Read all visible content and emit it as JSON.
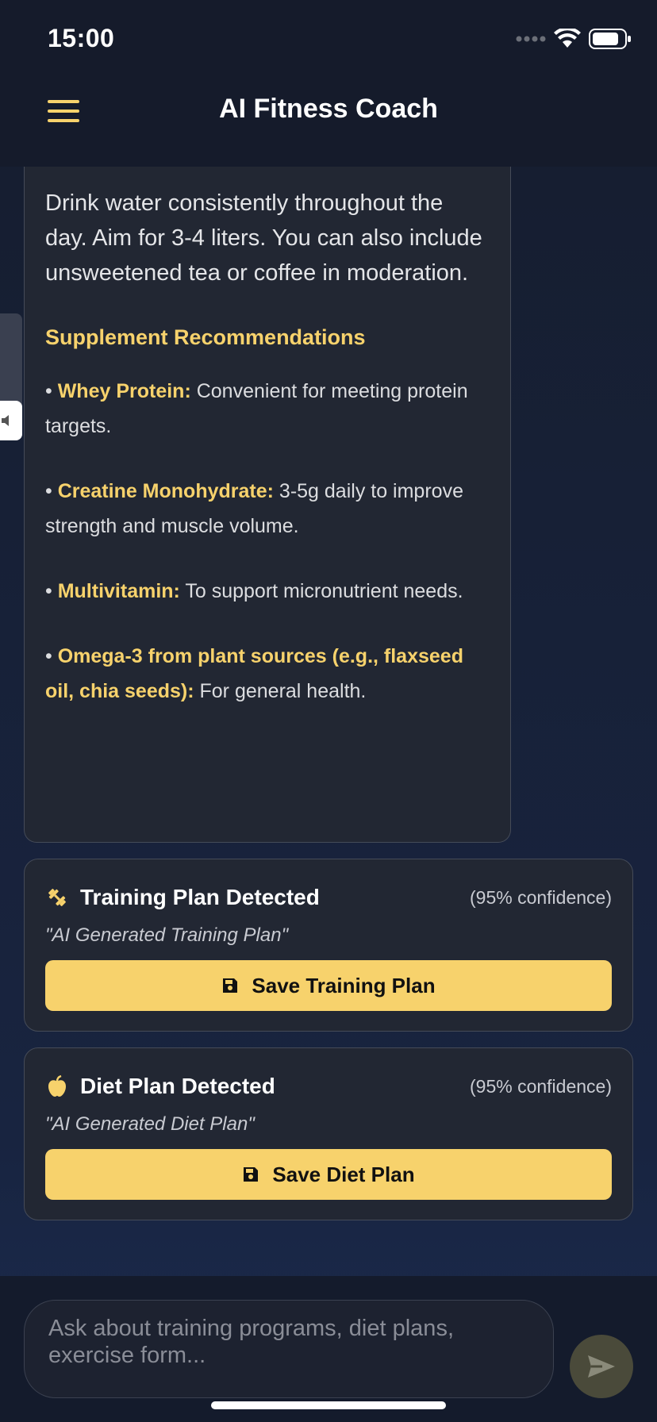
{
  "status_bar": {
    "time": "15:00"
  },
  "header": {
    "title": "AI Fitness Coach",
    "menu_icon": "hamburger-menu-icon"
  },
  "message": {
    "paragraph": "Drink water consistently throughout the day. Aim for 3-4 liters. You can also include unsweetened tea or coffee in moderation.",
    "heading": "Supplement Recommendations",
    "bullets": [
      {
        "prefix": "• ",
        "label": "Whey Protein:",
        "text": " Convenient for meeting protein targets."
      },
      {
        "prefix": "• ",
        "label": "Creatine Monohydrate:",
        "text": " 3-5g daily to improve strength and muscle volume."
      },
      {
        "prefix": "• ",
        "label": "Multivitamin:",
        "text": " To support micronutrient needs."
      },
      {
        "prefix": "• ",
        "label": "Omega-3 from plant sources (e.g., flaxseed oil, chia seeds):",
        "text": " For general health."
      }
    ]
  },
  "training_card": {
    "icon": "dumbbell-icon",
    "title": "Training Plan Detected",
    "confidence": "(95% confidence)",
    "plan_name": "\"AI Generated Training Plan\"",
    "button_label": "Save Training Plan"
  },
  "diet_card": {
    "icon": "apple-icon",
    "title": "Diet Plan Detected",
    "confidence": "(95% confidence)",
    "plan_name": "\"AI Generated Diet Plan\"",
    "button_label": "Save Diet Plan"
  },
  "chat_input": {
    "placeholder": "Ask about training programs, diet plans, exercise form..."
  },
  "colors": {
    "accent": "#f7d26c",
    "card_bg": "#222733",
    "page_bg": "#161d2e"
  }
}
